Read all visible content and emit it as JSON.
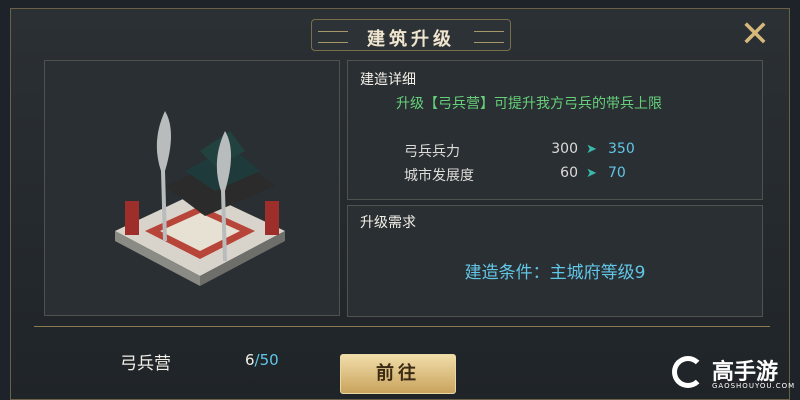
{
  "dialog": {
    "title": "建筑升级",
    "close_icon": "crossed-blades-close-icon"
  },
  "building": {
    "name": "弓兵营",
    "count_current": "6",
    "count_max": "/50",
    "image_icon": "archer-camp-building-icon"
  },
  "details": {
    "heading": "建造详细",
    "description": "升级【弓兵营】可提升我方弓兵的带兵上限",
    "stats": [
      {
        "label": "弓兵兵力",
        "old": "300",
        "arrow": "➤",
        "new": "350"
      },
      {
        "label": "城市发展度",
        "old": "60",
        "arrow": "➤",
        "new": "70"
      }
    ]
  },
  "requirements": {
    "heading": "升级需求",
    "condition": "建造条件：主城府等级9"
  },
  "actions": {
    "go_label": "前往"
  },
  "watermark": {
    "brand": "高手游",
    "domain": "GAOSHOUYOU.COM"
  },
  "colors": {
    "accent_blue": "#61c6e6",
    "accent_green": "#66d07a",
    "gold": "#c9a35e"
  }
}
